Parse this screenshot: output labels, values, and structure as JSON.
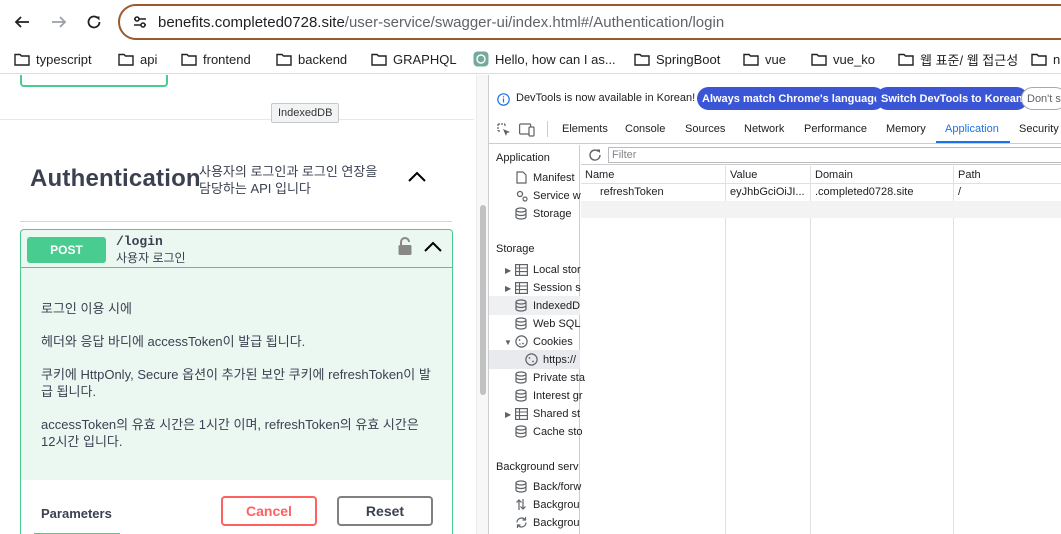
{
  "browser": {
    "url_host": "benefits.completed0728.site",
    "url_path": "/user-service/swagger-ui/index.html#/Authentication/login",
    "bookmarks": [
      {
        "label": "typescript",
        "icon": "folder-icon"
      },
      {
        "label": "api",
        "icon": "folder-icon"
      },
      {
        "label": "frontend",
        "icon": "folder-icon"
      },
      {
        "label": "backend",
        "icon": "folder-icon"
      },
      {
        "label": "GRAPHQL",
        "icon": "folder-icon"
      },
      {
        "label": "Hello, how can I as...",
        "icon": "chatgpt-icon"
      },
      {
        "label": "SpringBoot",
        "icon": "folder-icon"
      },
      {
        "label": "vue",
        "icon": "folder-icon"
      },
      {
        "label": "vue_ko",
        "icon": "folder-icon"
      },
      {
        "label": "웹 표준/ 웹 접근성",
        "icon": "folder-icon"
      },
      {
        "label": "n",
        "icon": "folder-icon"
      }
    ]
  },
  "swagger": {
    "tooltip": "IndexedDB",
    "tag": {
      "title": "Authentication",
      "description": "사용자의 로그인과 로그인 연장을 담당하는 API 입니다"
    },
    "operation": {
      "method": "POST",
      "path": "/login",
      "summary": "사용자 로그인",
      "description": [
        "로그인 이용 시에",
        "헤더와 응답 바디에 accessToken이 발급 됩니다.",
        "쿠키에 HttpOnly, Secure 옵션이 추가된 보안 쿠키에 refreshToken이 발급 됩니다.",
        "accessToken의 유효 시간은 1시간 이며, refreshToken의 유효 시간은 12시간 입니다."
      ],
      "parameters_label": "Parameters",
      "cancel_label": "Cancel",
      "reset_label": "Reset"
    },
    "colors": {
      "post": "#49cc90",
      "cancel": "#ff6060"
    }
  },
  "devtools": {
    "info_message": "DevTools is now available in Korean!",
    "info_buttons": [
      "Always match Chrome's language",
      "Switch DevTools to Korean",
      "Don't s"
    ],
    "tabs": [
      "Elements",
      "Console",
      "Sources",
      "Network",
      "Performance",
      "Memory",
      "Application",
      "Security"
    ],
    "active_tab": "Application",
    "sidebar": {
      "application_header": "Application",
      "application_items": [
        "Manifest",
        "Service w",
        "Storage"
      ],
      "storage_header": "Storage",
      "storage_items": [
        "Local stor",
        "Session s",
        "IndexedD",
        "Web SQL",
        "Cookies",
        "https://",
        "Private sta",
        "Interest gr",
        "Shared st",
        "Cache sto"
      ],
      "background_header": "Background serv",
      "background_items": [
        "Back/forw",
        "Backgrou",
        "Backgrou"
      ]
    },
    "filter_placeholder": "Filter",
    "cookies_table": {
      "columns": [
        "Name",
        "Value",
        "Domain",
        "Path"
      ],
      "rows": [
        {
          "name": "refreshToken",
          "value": "eyJhbGciOiJI...",
          "domain": ".completed0728.site",
          "path": "/"
        }
      ]
    }
  }
}
